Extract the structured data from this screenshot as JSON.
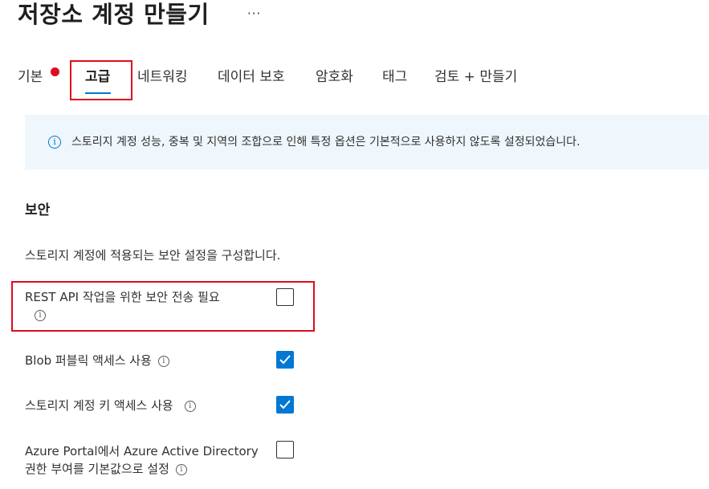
{
  "page": {
    "title": "저장소 계정 만들기",
    "more_label": "···"
  },
  "tabs": [
    {
      "label": "기본",
      "has_error": true
    },
    {
      "label": "고급",
      "active": true
    },
    {
      "label": "네트워킹"
    },
    {
      "label": "데이터 보호"
    },
    {
      "label": "암호화"
    },
    {
      "label": "태그"
    },
    {
      "label": "검토 + 만들기"
    }
  ],
  "info_bar": {
    "icon": "info-icon",
    "text": "스토리지 계정 성능, 중복 및 지역의 조합으로 인해 특정 옵션은 기본적으로 사용하지 않도록 설정되었습니다."
  },
  "security": {
    "heading": "보안",
    "description": "스토리지 계정에 적용되는 보안 설정을 구성합니다.",
    "settings": [
      {
        "label_line1": "REST API 작업을 위한 보안 전송 필요",
        "label_line2": "",
        "checked": false
      },
      {
        "label_line1": "Blob 퍼블릭 액세스 사용",
        "label_line2": "",
        "checked": true
      },
      {
        "label_line1": "스토리지 계정 키 액세스 사용",
        "label_line2": "",
        "checked": true
      },
      {
        "label_line1": "Azure Portal에서 Azure Active Directory",
        "label_line2": "권한 부여를 기본값으로 설정",
        "checked": false
      }
    ]
  },
  "colors": {
    "accent": "#0078d4",
    "error": "#e00b1c",
    "info_bg": "#eff6fc"
  }
}
